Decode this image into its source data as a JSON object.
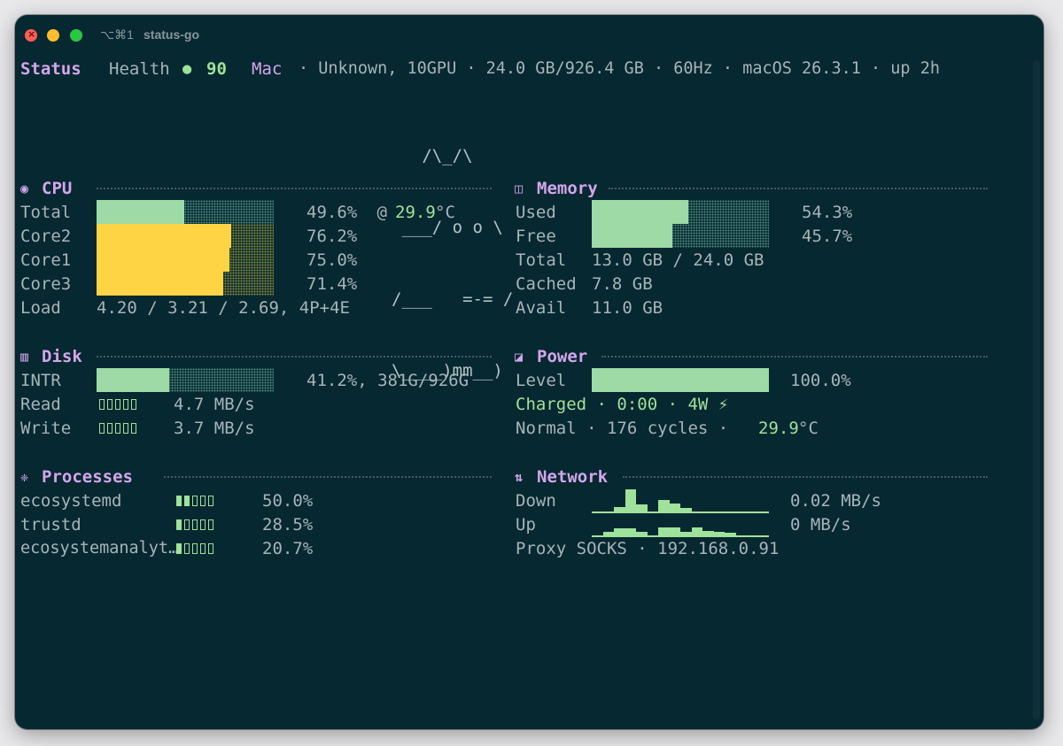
{
  "window": {
    "shortcut": "⌥⌘1",
    "title": "status-go"
  },
  "status": {
    "label": "Status",
    "health_label": "Health",
    "health_dot": "●",
    "health_value": "90",
    "machine": "Mac",
    "info": "· Unknown, 10GPU · 24.0 GB/926.4 GB · 60Hz · macOS 26.3.1 · up 2h"
  },
  "mascot": [
    "   /\\_/\\",
    " ___/ o o \\",
    "/___   =-= /",
    "\\____)mm__)"
  ],
  "cpu": {
    "icon": "◉",
    "title": "CPU",
    "rows": [
      {
        "label": "Total",
        "percent": 49.6,
        "value": "49.6%",
        "extra_prefix": " @ ",
        "temp": "29.9",
        "temp_unit": "°C",
        "color": "#9ddaa5"
      },
      {
        "label": "Core2",
        "percent": 76.2,
        "value": "76.2%",
        "color": "#fed444"
      },
      {
        "label": "Core1",
        "percent": 75.0,
        "value": "75.0%",
        "color": "#fed444"
      },
      {
        "label": "Core3",
        "percent": 71.4,
        "value": "71.4%",
        "color": "#fed444"
      }
    ],
    "load_label": "Load",
    "load_value": "4.20 / 3.21 / 2.69, 4P+4E"
  },
  "memory": {
    "icon": "◫",
    "title": "Memory",
    "used_label": "Used",
    "used_percent": 54.3,
    "used_value": "54.3%",
    "free_label": "Free",
    "free_percent": 45.7,
    "free_value": "45.7%",
    "total_label": "Total",
    "total_value": "13.0 GB / 24.0 GB",
    "cached_label": "Cached",
    "cached_value": "7.8 GB",
    "avail_label": "Avail",
    "avail_value": "11.0 GB"
  },
  "disk": {
    "icon": "▥",
    "title": "Disk",
    "intr_label": "INTR",
    "intr_percent": 41.2,
    "intr_value": "41.2%, 381G/926G",
    "read_label": "Read",
    "read_level": 0,
    "read_value": "4.7 MB/s",
    "write_label": "Write",
    "write_level": 0,
    "write_value": "3.7 MB/s"
  },
  "power": {
    "icon": "◪",
    "title": "Power",
    "level_label": "Level",
    "level_percent": 100.0,
    "level_value": "100.0%",
    "charged_text": "Charged · 0:00 · 4W ⚡",
    "normal_text": "Normal · 176 cycles · ",
    "temp": "29.9",
    "temp_unit": "°C"
  },
  "processes": {
    "icon": "❈",
    "title": "Processes",
    "items": [
      {
        "name": "ecosystemd",
        "level": 2,
        "value": "50.0%"
      },
      {
        "name": "trustd",
        "level": 1,
        "value": "28.5%"
      },
      {
        "name": "ecosystemanalyt…",
        "level": 1,
        "value": "20.7%"
      }
    ]
  },
  "network": {
    "icon": "⇅",
    "title": "Network",
    "down_label": "Down",
    "down_value": "0.02 MB/s",
    "down_history": [
      0,
      0,
      0.18,
      0.95,
      0.3,
      0,
      0.5,
      0.35,
      0.15,
      0,
      0,
      0,
      0,
      0,
      0,
      0
    ],
    "up_label": "Up",
    "up_value": "0 MB/s",
    "up_history": [
      0,
      0.15,
      0.3,
      0.3,
      0.15,
      0,
      0.35,
      0.35,
      0.15,
      0.35,
      0.2,
      0.15,
      0.1,
      0,
      0,
      0
    ],
    "proxy_text": "Proxy SOCKS · 192.168.0.91"
  },
  "colors": {
    "background": "#062830",
    "accent_purple": "#d3a6ec",
    "accent_green": "#9ee29b",
    "bar_yellow": "#fed444"
  }
}
